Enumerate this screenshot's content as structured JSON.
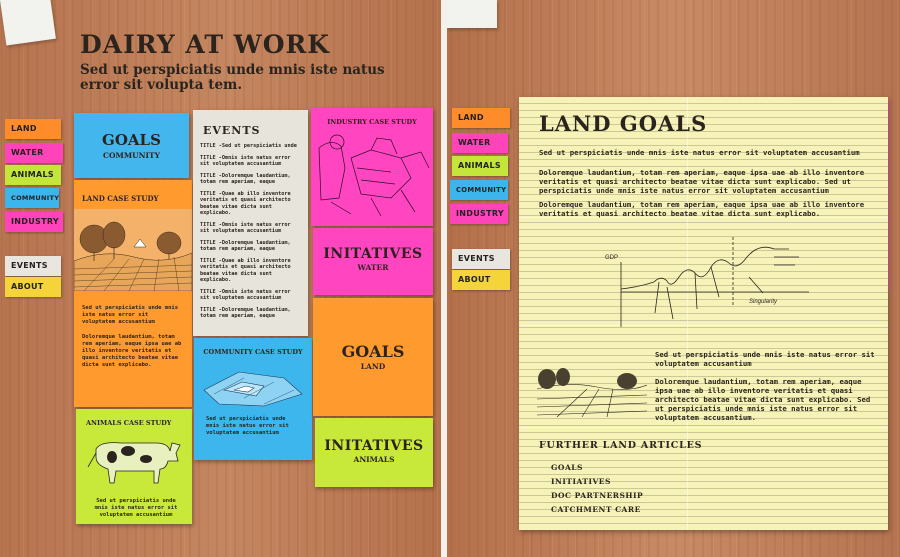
{
  "left": {
    "title": "DAIRY AT WORK",
    "subtitle": "Sed ut perspiciatis unde mnis iste natus error sit volupta tem.",
    "nav": [
      {
        "label": "LAND",
        "color": "#ff8c2a"
      },
      {
        "label": "WATER",
        "color": "#ff43b8"
      },
      {
        "label": "ANIMALS",
        "color": "#c4e53a"
      },
      {
        "label": "COMMUNITY",
        "color": "#3cb4ec"
      },
      {
        "label": "INDUSTRY",
        "color": "#ff43b8"
      }
    ],
    "nav2": [
      {
        "label": "EVENTS",
        "color": "#e9e6df"
      },
      {
        "label": "ABOUT",
        "color": "#f4d43a"
      }
    ],
    "goals_community": {
      "title": "GOALS",
      "sub": "COMMUNITY"
    },
    "land_case": {
      "title": "LAND CASE STUDY",
      "p1": "Sed ut perspiciatis unde mnis iste natus error sit voluptatem accusantium",
      "p2": "Doloremque laudantium, totam rem aperiam, eaque ipsa uae ab illo inventore veritatis et quasi architecto beatae vitae dicta sunt explicabo."
    },
    "animals_case": {
      "title": "ANIMALS CASE STUDY",
      "p1": "Sed ut perspiciatis unde mnis iste natus error sit voluptatem accusantium"
    },
    "events": {
      "title": "EVENTS",
      "items": [
        "TITLE -Sed ut perspiciatis unde",
        "TITLE -Omnis iste natus error sit voluptatem accusantium",
        "TITLE -Doloremque laudantium, totam rem aperiam, eaque",
        "TITLE -Quae ab illo inventore veritatis et quasi architecto beatae vitae dicta sunt explicabo.",
        "TITLE -Omnis iste natus error sit voluptatem accusantium",
        "TITLE -Doloremque laudantium, totam rem aperiam, eaque",
        "TITLE -Quae ab illo inventore veritatis et quasi architecto beatae vitae dicta sunt explicabo.",
        "TITLE -Omnis iste natus error sit voluptatem accusantium",
        "TITLE -Doloremque laudantium, totam rem aperiam, eaque"
      ]
    },
    "community_case": {
      "title": "COMMUNITY CASE STUDY",
      "p1": "Sed ut perspiciatis unde mnis iste natus error sit voluptatem accusantium"
    },
    "industry_case": {
      "title": "INDUSTRY CASE STUDY"
    },
    "initatives_water": {
      "title": "INITATIVES",
      "sub": "WATER"
    },
    "goals_land": {
      "title": "GOALS",
      "sub": "LAND"
    },
    "initatives_animals": {
      "title": "INITATIVES",
      "sub": "ANIMALS"
    }
  },
  "right": {
    "nav": [
      {
        "label": "LAND",
        "color": "#ff8c2a"
      },
      {
        "label": "WATER",
        "color": "#ff43b8"
      },
      {
        "label": "ANIMALS",
        "color": "#c4e53a"
      },
      {
        "label": "COMMUNITY",
        "color": "#3cb4ec"
      },
      {
        "label": "INDUSTRY",
        "color": "#ff43b8"
      }
    ],
    "nav2": [
      {
        "label": "EVENTS",
        "color": "#e9e6df"
      },
      {
        "label": "ABOUT",
        "color": "#f4d43a"
      }
    ],
    "title": "LAND GOALS",
    "intro": "Sed ut perspiciatis unde mnis iste natus error sit voluptatem accusantium",
    "p1": "Doloremque laudantium, totam rem aperiam, eaque ipsa uae ab illo inventore veritatis et quasi architecto beatae vitae dicta sunt explicabo. Sed ut perspiciatis unde mnis iste natus error sit voluptatem accusantium",
    "p2": "Doloremque laudantium, totam rem aperiam, eaque ipsa uae ab illo inventore veritatis et quasi architecto beatae vitae dicta sunt explicabo.",
    "graph_labels": {
      "gdp": "GDP",
      "singularity": "Singularity"
    },
    "p3": "Sed ut perspiciatis unde mnis iste natus error sit voluptatem accusantium",
    "p4": "Doloremque laudantium, totam rem aperiam, eaque ipsa uae ab illo inventore veritatis et quasi architecto beatae vitae dicta sunt explicabo. Sed ut perspiciatis unde mnis iste natus error sit voluptatem accusantium.",
    "further": {
      "title": "FURTHER LAND ARTICLES",
      "items": [
        "GOALS",
        "INITIATIVES",
        "DOC PARTNERSHIP",
        "CATCHMENT CARE"
      ]
    }
  }
}
